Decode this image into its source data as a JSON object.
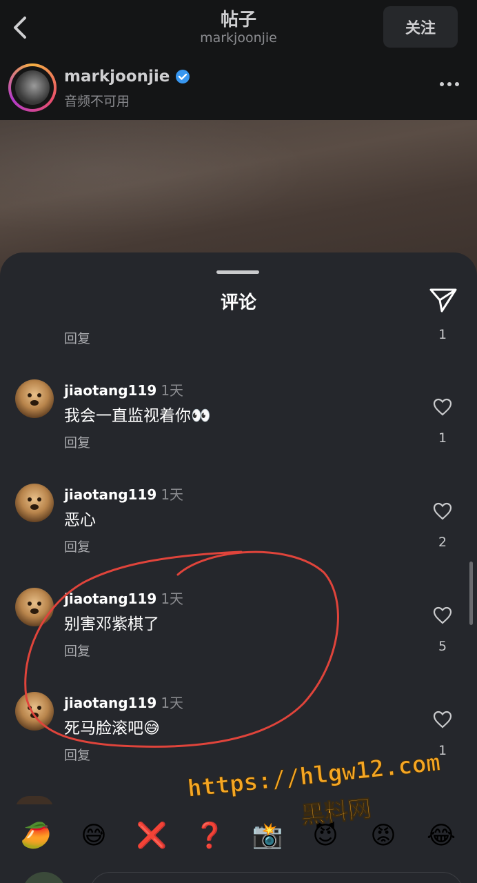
{
  "header": {
    "title": "帖子",
    "subtitle": "markjoonjie",
    "follow_label": "关注"
  },
  "author": {
    "name": "markjoonjie",
    "subtext": "音频不可用"
  },
  "sheet": {
    "title": "评论",
    "previous": {
      "reply_label": "回复",
      "like_count": "1"
    }
  },
  "comments": [
    {
      "user": "jiaotang119",
      "time": "1天",
      "text": "我会一直监视着你👀",
      "reply_label": "回复",
      "like_count": "1"
    },
    {
      "user": "jiaotang119",
      "time": "1天",
      "text": "恶心",
      "reply_label": "回复",
      "like_count": "2"
    },
    {
      "user": "jiaotang119",
      "time": "1天",
      "text": "别害邓紫棋了",
      "reply_label": "回复",
      "like_count": "5"
    },
    {
      "user": "jiaotang119",
      "time": "1天",
      "text": "死马脸滚吧😅",
      "reply_label": "回复",
      "like_count": "1"
    }
  ],
  "emoji_bar": [
    "🥭",
    "😅",
    "❌",
    "❓",
    "📸",
    "😈",
    "😡",
    "😂"
  ],
  "watermark": {
    "line1": "https://hlgw12.com",
    "line2": "黑料网"
  },
  "colors": {
    "background": "#25272c",
    "annotation_circle": "#e0443b",
    "watermark": "#f5a623",
    "verified": "#3897f0"
  }
}
